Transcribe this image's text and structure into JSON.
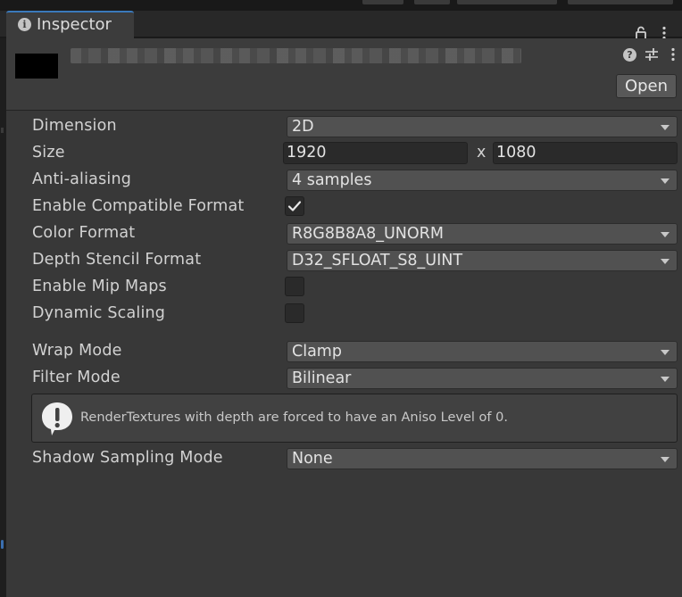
{
  "window": {
    "tab_title": "Inspector"
  },
  "header": {
    "open_label": "Open"
  },
  "properties": {
    "dimension": {
      "label": "Dimension",
      "value": "2D"
    },
    "size": {
      "label": "Size",
      "width": "1920",
      "separator": "x",
      "height": "1080"
    },
    "anti_aliasing": {
      "label": "Anti-aliasing",
      "value": "4 samples"
    },
    "enable_compatible_format": {
      "label": "Enable Compatible Format",
      "checked": true
    },
    "color_format": {
      "label": "Color Format",
      "value": "R8G8B8A8_UNORM"
    },
    "depth_stencil_format": {
      "label": "Depth Stencil Format",
      "value": "D32_SFLOAT_S8_UINT"
    },
    "enable_mip_maps": {
      "label": "Enable Mip Maps",
      "checked": false
    },
    "dynamic_scaling": {
      "label": "Dynamic Scaling",
      "checked": false
    },
    "wrap_mode": {
      "label": "Wrap Mode",
      "value": "Clamp"
    },
    "filter_mode": {
      "label": "Filter Mode",
      "value": "Bilinear"
    },
    "help_message": "RenderTextures with depth are forced to have an Aniso Level of 0.",
    "shadow_sampling_mode": {
      "label": "Shadow Sampling Mode",
      "value": "None"
    }
  },
  "icons": {
    "tab": "info-icon",
    "lock": "lock-icon",
    "help": "help-icon",
    "presets": "presets-icon",
    "menu": "kebab-menu-icon",
    "warning": "warning-speech-icon",
    "check": "checkmark-icon"
  },
  "colors": {
    "panel_bg": "#383838",
    "header_bg": "#3c3c3c",
    "field_bg": "#515151",
    "text": "#d2d2d2",
    "tab_accent": "#3a79bb"
  }
}
